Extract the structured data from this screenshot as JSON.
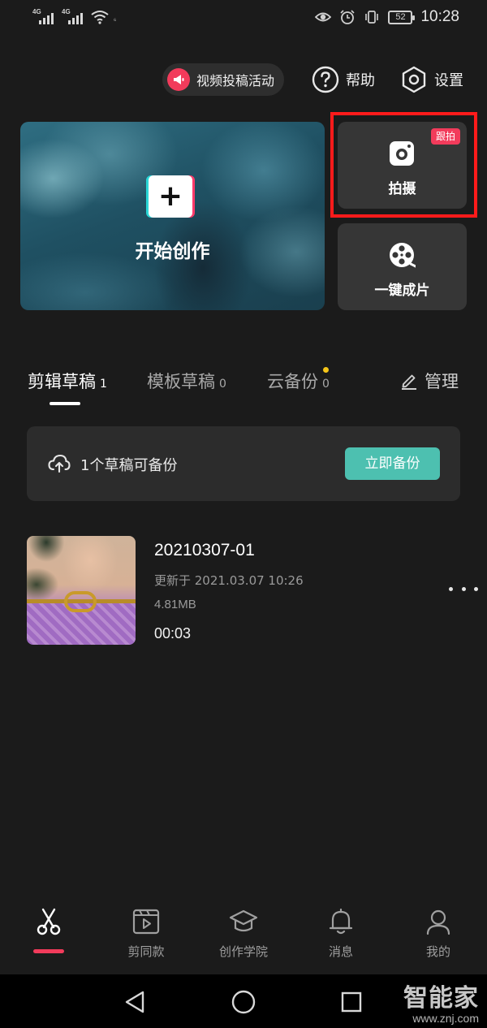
{
  "status_bar": {
    "sim1_tag": "4G",
    "sim2_tag": "4G",
    "hd_tag": "⁶",
    "battery": "52",
    "time": "10:28"
  },
  "top_actions": {
    "activity_label": "视频投稿活动",
    "help_label": "帮助",
    "settings_label": "设置"
  },
  "hero": {
    "plus_glyph": "+",
    "label": "开始创作"
  },
  "cards": {
    "shoot_label": "拍摄",
    "shoot_badge": "跟拍",
    "oneclick_label": "一键成片"
  },
  "tabs": [
    {
      "label": "剪辑草稿",
      "count": "1"
    },
    {
      "label": "模板草稿",
      "count": "0"
    },
    {
      "label": "云备份",
      "count": "0"
    }
  ],
  "manage_label": "管理",
  "backup": {
    "text": "1个草稿可备份",
    "button": "立即备份"
  },
  "draft": {
    "name": "20210307-01",
    "updated": "更新于 2021.03.07 10:26",
    "size": "4.81MB",
    "duration": "00:03"
  },
  "bottom_nav": [
    {
      "label": "",
      "icon": "scissors-icon"
    },
    {
      "label": "剪同款",
      "icon": "template-play-icon"
    },
    {
      "label": "创作学院",
      "icon": "graduation-cap-icon"
    },
    {
      "label": "消息",
      "icon": "bell-icon"
    },
    {
      "label": "我的",
      "icon": "person-icon"
    }
  ],
  "watermark": {
    "title": "智能家",
    "url": "www.znj.com"
  },
  "colors": {
    "background": "#1b1b1b",
    "accent_red": "#f23b5b",
    "backup_green": "#4dc0b0",
    "highlight_red": "#ff1b1b"
  }
}
